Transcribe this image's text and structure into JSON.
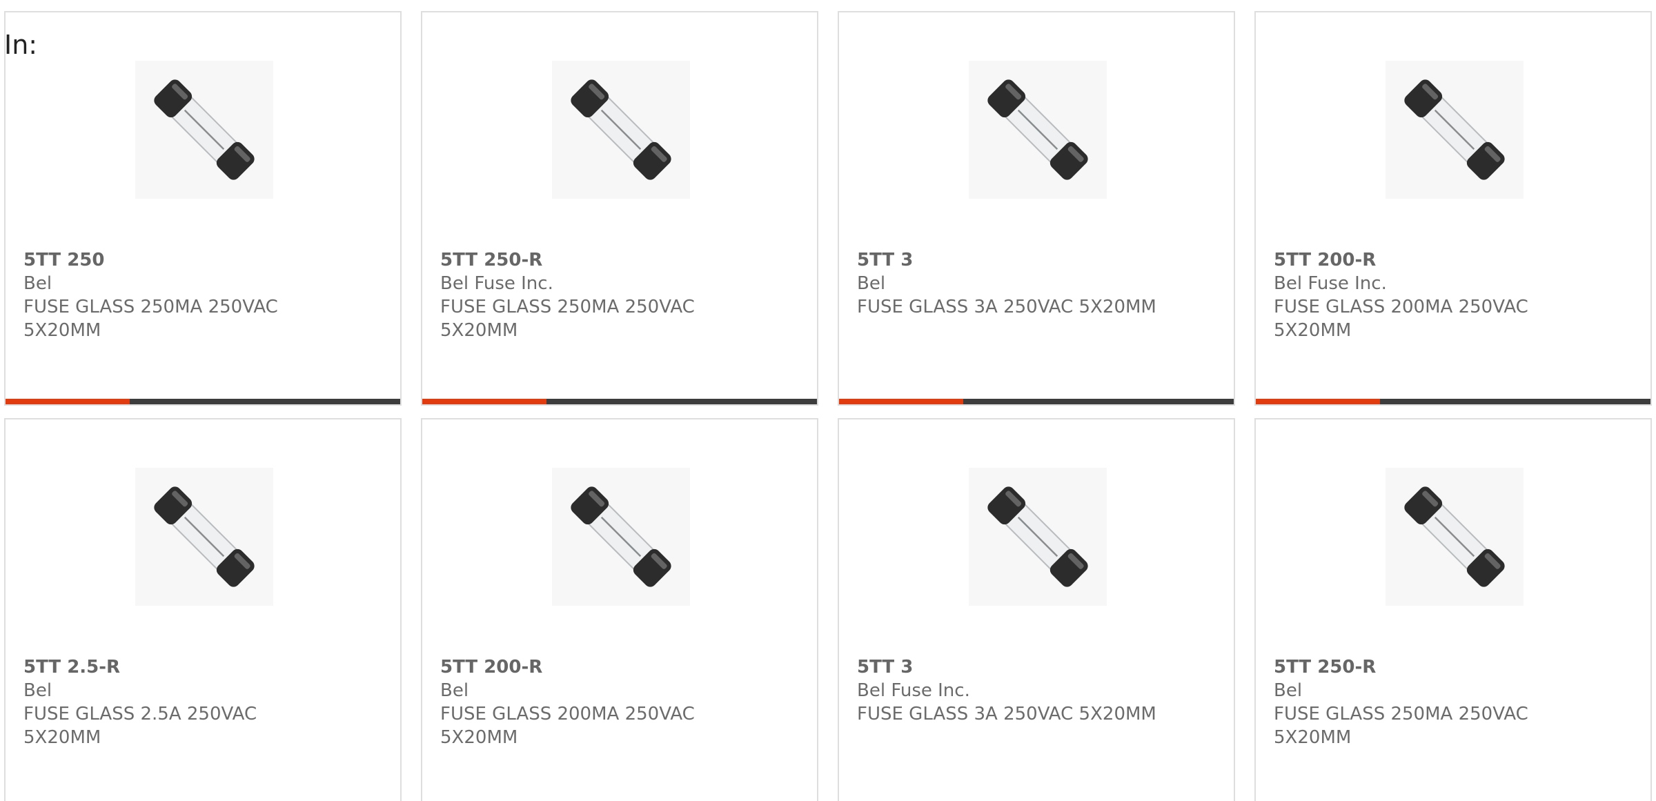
{
  "header": {
    "label": "In:"
  },
  "colors": {
    "accent": "#e03c10",
    "bar_track": "#3d3d3d",
    "text": "#6b6b6b",
    "border": "#dedede"
  },
  "products": [
    {
      "part": "5TT 250",
      "manufacturer": "Bel",
      "description": "FUSE GLASS 250MA 250VAC 5X20MM",
      "icon": "glass-fuse-image",
      "progress": 0.315
    },
    {
      "part": "5TT 250-R",
      "manufacturer": "Bel Fuse Inc.",
      "description": "FUSE GLASS 250MA 250VAC 5X20MM",
      "icon": "glass-fuse-image",
      "progress": 0.315
    },
    {
      "part": "5TT 3",
      "manufacturer": "Bel",
      "description": "FUSE GLASS 3A 250VAC 5X20MM",
      "icon": "glass-fuse-image",
      "progress": 0.315
    },
    {
      "part": "5TT 200-R",
      "manufacturer": "Bel Fuse Inc.",
      "description": "FUSE GLASS 200MA 250VAC 5X20MM",
      "icon": "glass-fuse-image",
      "progress": 0.315
    },
    {
      "part": "5TT 2.5-R",
      "manufacturer": "Bel",
      "description": "FUSE GLASS 2.5A 250VAC 5X20MM",
      "icon": "glass-fuse-image"
    },
    {
      "part": "5TT 200-R",
      "manufacturer": "Bel",
      "description": "FUSE GLASS 200MA 250VAC 5X20MM",
      "icon": "glass-fuse-image"
    },
    {
      "part": "5TT 3",
      "manufacturer": "Bel Fuse Inc.",
      "description": "FUSE GLASS 3A 250VAC 5X20MM",
      "icon": "glass-fuse-image"
    },
    {
      "part": "5TT 250-R",
      "manufacturer": "Bel",
      "description": "FUSE GLASS 250MA 250VAC 5X20MM",
      "icon": "glass-fuse-image"
    }
  ]
}
